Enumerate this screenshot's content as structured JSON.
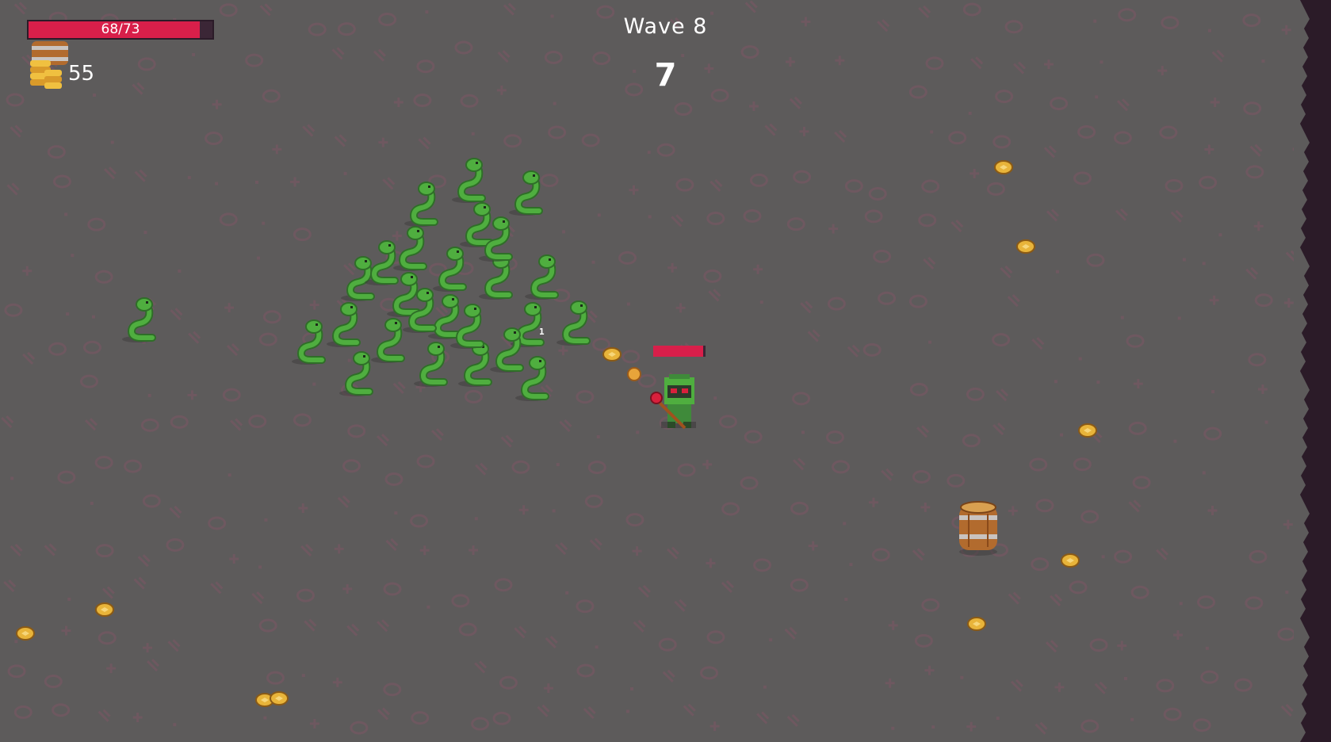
{
  "hud": {
    "health": {
      "current": 68,
      "max": 73,
      "text": "68/73"
    },
    "gold": {
      "count": "55"
    },
    "wave": {
      "title": "Wave 8",
      "timer": "7"
    }
  },
  "player": {
    "health_fraction": 0.95,
    "weapon": "staff-icon"
  },
  "effects": {
    "damage_number": "1"
  },
  "colors": {
    "floor": "#5d5b5b",
    "floor_pattern": "#6e5860",
    "health_red": "#d81f4a",
    "health_bg": "#3b2636",
    "snake_green": "#4fae3f",
    "coin_gold": "#e8b43a",
    "edge_dark": "#2b1b28"
  },
  "entities": {
    "snake_count": 26,
    "coin_count": 14,
    "barrel_count": 1
  }
}
